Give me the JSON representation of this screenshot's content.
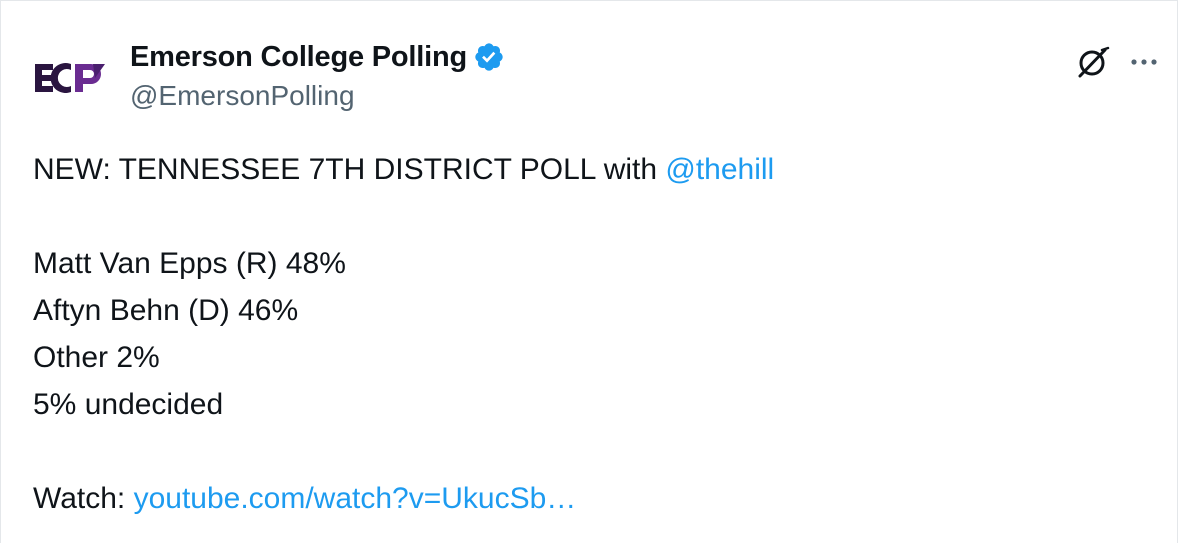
{
  "tweet": {
    "author": {
      "display_name": "Emerson College Polling",
      "handle": "@EmersonPolling",
      "avatar_text": "ECP",
      "verified": true,
      "avatar_icon": "ecp-logo-icon",
      "verified_icon": "verified-badge-icon"
    },
    "actions": {
      "grok_icon": "grok-icon",
      "more_icon": "more-options-icon",
      "more_label": "···"
    },
    "body": {
      "headline_prefix": "NEW: TENNESSEE 7TH DISTRICT POLL with ",
      "headline_mention": "@thehill",
      "results": [
        "Matt Van Epps (R) 48%",
        "Aftyn Behn (D) 46%",
        "Other 2%",
        "5% undecided"
      ],
      "watch_prefix": "Watch: ",
      "watch_link": "youtube.com/watch?v=UkucSb…"
    }
  },
  "colors": {
    "text": "#0f1419",
    "secondary_text": "#536471",
    "link": "#1d9bf0",
    "verified": "#1d9bf0",
    "brand_purple": "#3d1f5c"
  }
}
